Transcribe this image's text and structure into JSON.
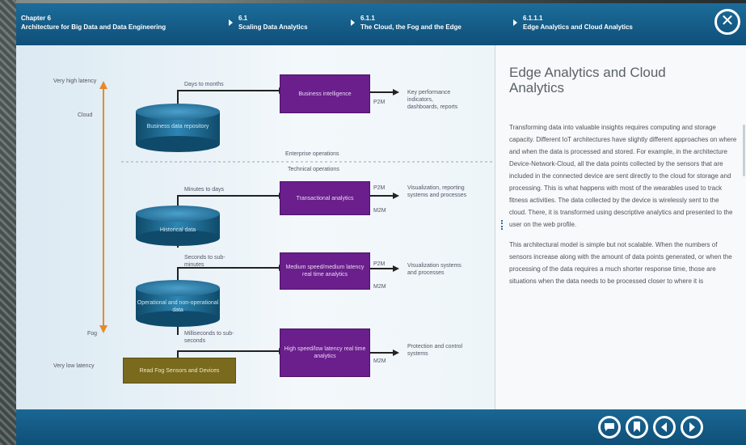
{
  "header": {
    "crumbs": [
      {
        "num": "Chapter 6",
        "label": "Architecture for Big Data and Data Engineering"
      },
      {
        "num": "6.1",
        "label": "Scaling Data Analytics"
      },
      {
        "num": "6.1.1",
        "label": "The Cloud, the Fog and the Edge"
      },
      {
        "num": "6.1.1.1",
        "label": "Edge Analytics and Cloud Analytics"
      }
    ],
    "close_symbol": "✕"
  },
  "diagram": {
    "latency_high": "Very high latency",
    "latency_low": "Very low latency",
    "cloud": "Cloud",
    "fog": "Fog",
    "enterprise": "Enterprise operations",
    "technical": "Technical operations",
    "arrows": [
      "Days to months",
      "Minutes to days",
      "Seconds to sub-minutes",
      "Milliseconds to sub-seconds"
    ],
    "cylinders": [
      "Business data repository",
      "Historical data",
      "Operational and non-operational data"
    ],
    "fog_box": "Read Fog Sensors and Devices",
    "boxes": [
      "Business intelligence",
      "Transactional analytics",
      "Medium speed/medium latency real time analytics",
      "High speed/low latency real time analytics"
    ],
    "p2m": "P2M",
    "m2m": "M2M",
    "outcomes": [
      "Key performance indicators, dashboards, reports",
      "Visualization, reporting systems and processes",
      "Visualization systems and processes",
      "Protection and control systems"
    ]
  },
  "side": {
    "title": "Edge Analytics and Cloud Analytics",
    "para1": "Transforming data into valuable insights requires computing and storage capacity. Different IoT architectures have slightly different approaches on where and when the data is processed and stored. For example, in the architecture Device-Network-Cloud, all the data points collected by the sensors that are included in the connected device are sent directly to the cloud for storage and processing. This is what happens with most of the wearables used to track fitness activities. The data collected by the device is wirelessly sent to the cloud. There, it is transformed using descriptive analytics and presented to the user on the web profile.",
    "para2": "This architectural model is simple but not scalable. When the numbers of sensors increase along with the amount of data points generated, or when the processing of the data requires a much shorter response time, those are situations when the data needs to be processed closer to where it is"
  },
  "footer": {
    "comment_icon": "speech-bubble-icon",
    "bookmark_icon": "bookmark-icon",
    "prev_icon": "chevron-left-icon",
    "next_icon": "chevron-right-icon"
  }
}
